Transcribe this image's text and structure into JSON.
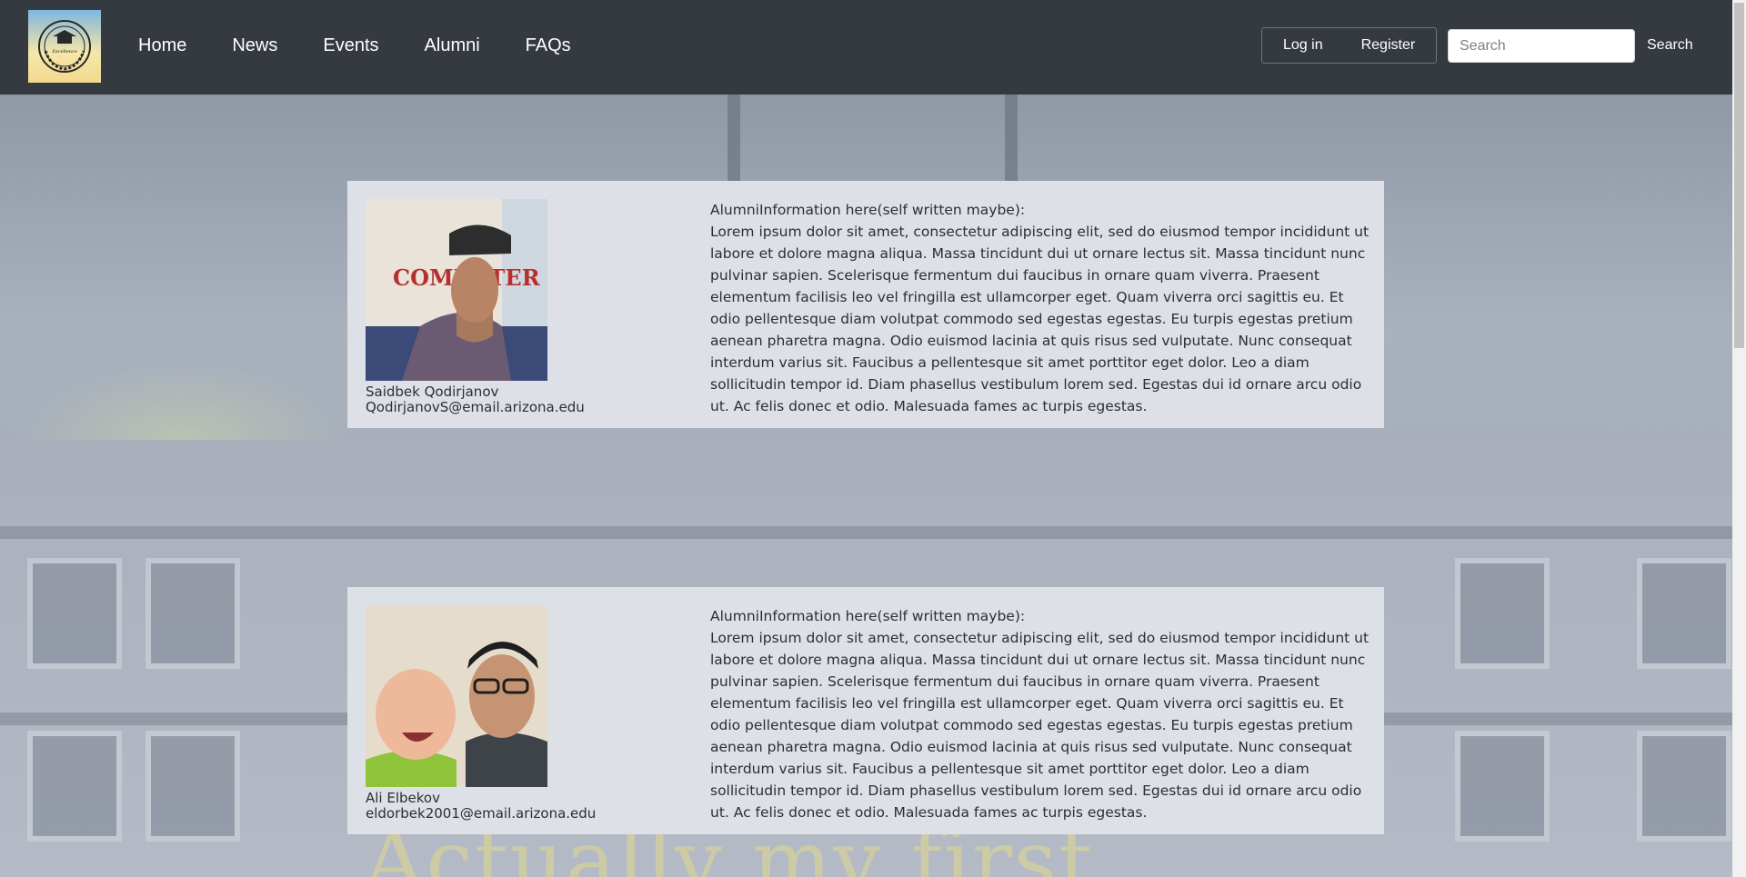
{
  "nav": {
    "logo_text": "Excellence",
    "links": [
      "Home",
      "News",
      "Events",
      "Alumni",
      "FAQs"
    ],
    "login_label": "Log in",
    "register_label": "Register",
    "search_placeholder": "Search",
    "search_button": "Search"
  },
  "background": {
    "sign_text": "Actually my first"
  },
  "alumni": [
    {
      "name": "Saidbek Qodirjanov",
      "email": "QodirjanovS@email.arizona.edu",
      "photo_sign": "COMPUTER SCIENCE",
      "info_heading": "AlumniInformation here(self written maybe):",
      "info_body": "Lorem ipsum dolor sit amet, consectetur adipiscing elit, sed do eiusmod tempor incididunt ut labore et dolore magna aliqua. Massa tincidunt dui ut ornare lectus sit. Massa tincidunt nunc pulvinar sapien. Scelerisque fermentum dui faucibus in ornare quam viverra. Praesent elementum facilisis leo vel fringilla est ullamcorper eget. Quam viverra orci sagittis eu. Et odio pellentesque diam volutpat commodo sed egestas egestas. Eu turpis egestas pretium aenean pharetra magna. Odio euismod lacinia at quis risus sed vulputate. Nunc consequat interdum varius sit. Faucibus a pellentesque sit amet porttitor eget dolor. Leo a diam sollicitudin tempor id. Diam phasellus vestibulum lorem sed. Egestas dui id ornare arcu odio ut. Ac felis donec et odio. Malesuada fames ac turpis egestas."
    },
    {
      "name": "Ali Elbekov",
      "email": "eldorbek2001@email.arizona.edu",
      "info_heading": "AlumniInformation here(self written maybe):",
      "info_body": "Lorem ipsum dolor sit amet, consectetur adipiscing elit, sed do eiusmod tempor incididunt ut labore et dolore magna aliqua. Massa tincidunt dui ut ornare lectus sit. Massa tincidunt nunc pulvinar sapien. Scelerisque fermentum dui faucibus in ornare quam viverra. Praesent elementum facilisis leo vel fringilla est ullamcorper eget. Quam viverra orci sagittis eu. Et odio pellentesque diam volutpat commodo sed egestas egestas. Eu turpis egestas pretium aenean pharetra magna. Odio euismod lacinia at quis risus sed vulputate. Nunc consequat interdum varius sit. Faucibus a pellentesque sit amet porttitor eget dolor. Leo a diam sollicitudin tempor id. Diam phasellus vestibulum lorem sed. Egestas dui id ornare arcu odio ut. Ac felis donec et odio. Malesuada fames ac turpis egestas."
    }
  ]
}
